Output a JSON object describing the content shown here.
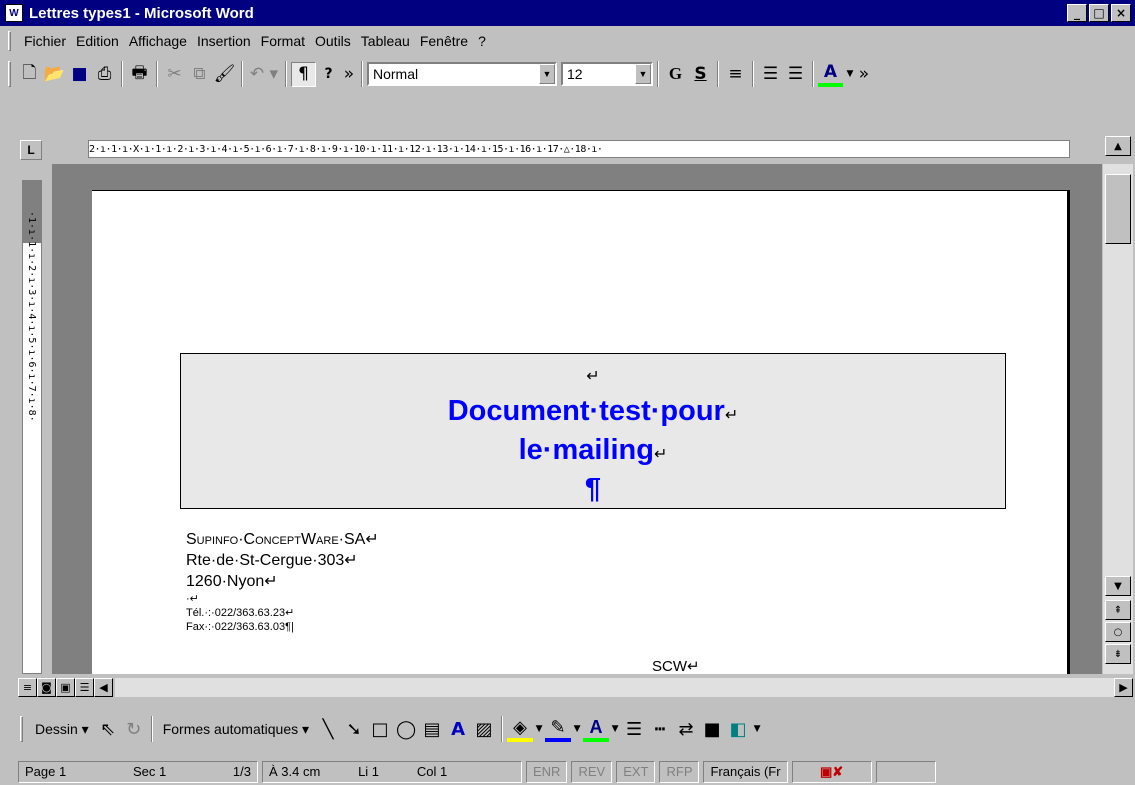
{
  "window": {
    "title": "Lettres types1 - Microsoft Word",
    "app_icon": "W",
    "minimize": "_",
    "maximize": "□",
    "close": "×"
  },
  "menu": [
    "Fichier",
    "Edition",
    "Affichage",
    "Insertion",
    "Format",
    "Outils",
    "Tableau",
    "Fenêtre",
    "?"
  ],
  "toolbar": {
    "style_value": "Normal",
    "size_value": "12",
    "bold_label": "G",
    "underline_label": "S",
    "font_color_label": "A",
    "more_label": "»"
  },
  "ruler": {
    "corner": "L",
    "text": "2·ı·1·ı·X·ı·1·ı·2·ı·3·ı·4·ı·5·ı·6·ı·7·ı·8·ı·9·ı·10·ı·11·ı·12·ı·13·ı·14·ı·15·ı·16·ı·17·△·18·ı·"
  },
  "vruler": {
    "text": "·1·ı·1·ı·2·ı·3·ı·4·ı·5·ı·6·ı·7·ı·8·"
  },
  "document": {
    "heading_line1": "Document·test·pour",
    "heading_line2": "le·mailing",
    "pilcrow": "¶",
    "return_mark": "↵",
    "addr_line1": "Supinfo·ConceptWare·SA",
    "addr_line2": "Rte·de·St-Cergue·303",
    "addr_line3": "1260·Nyon",
    "addr_line4": "·",
    "tel": "Tél.·:·022/363.63.23",
    "fax": "Fax·:·022/363.63.03¶|",
    "scw": "SCW"
  },
  "drawing": {
    "dessin": "Dessin ▾",
    "autoshapes": "Formes automatiques ▾"
  },
  "status": {
    "page": "Page 1",
    "sec": "Sec 1",
    "pages": "1/3",
    "at": "À 3.4 cm",
    "line": "Li 1",
    "col": "Col 1",
    "enr": "ENR",
    "rev": "REV",
    "ext": "EXT",
    "rfp": "RFP",
    "lang": "Français (Fr"
  }
}
